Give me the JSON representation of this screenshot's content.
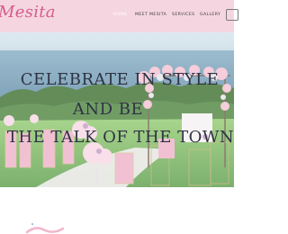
{
  "site": {
    "logo": "Mesita"
  },
  "nav": {
    "home": "HOME",
    "meet": "MEET MESITA",
    "services": "SERVICES",
    "gallery": "GALLERY"
  },
  "hero": {
    "line1": "CELEBRATE IN STYLE",
    "line2": "AND BE",
    "line3": "THE TALK OF THE TOWN"
  },
  "colors": {
    "header_bg": "#f5d6e0",
    "logo": "#d65b8c",
    "hero_text": "#2f3243"
  }
}
